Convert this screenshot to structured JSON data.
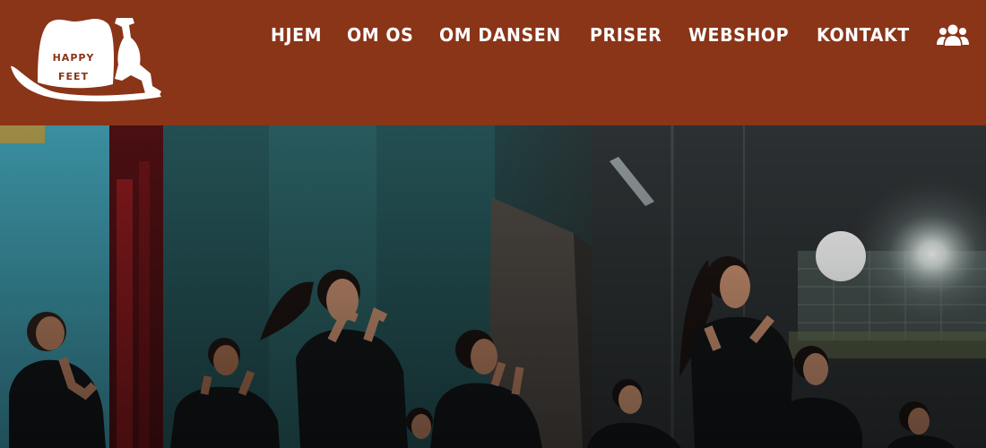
{
  "logo": {
    "line1": "HAPPY",
    "line2": "FEET"
  },
  "nav": {
    "items": [
      {
        "label": "HJEM"
      },
      {
        "label": "OM OS"
      },
      {
        "label": "OM DANSEN"
      },
      {
        "label": "PRISER"
      },
      {
        "label": "WEBSHOP"
      },
      {
        "label": "KONTAKT"
      }
    ],
    "icons": [
      "users-icon",
      "sign-out-icon"
    ]
  },
  "hero": {
    "image": "dancers-performing-photo"
  },
  "colors": {
    "header_bg": "#8a3418",
    "nav_text": "#ffffff"
  }
}
